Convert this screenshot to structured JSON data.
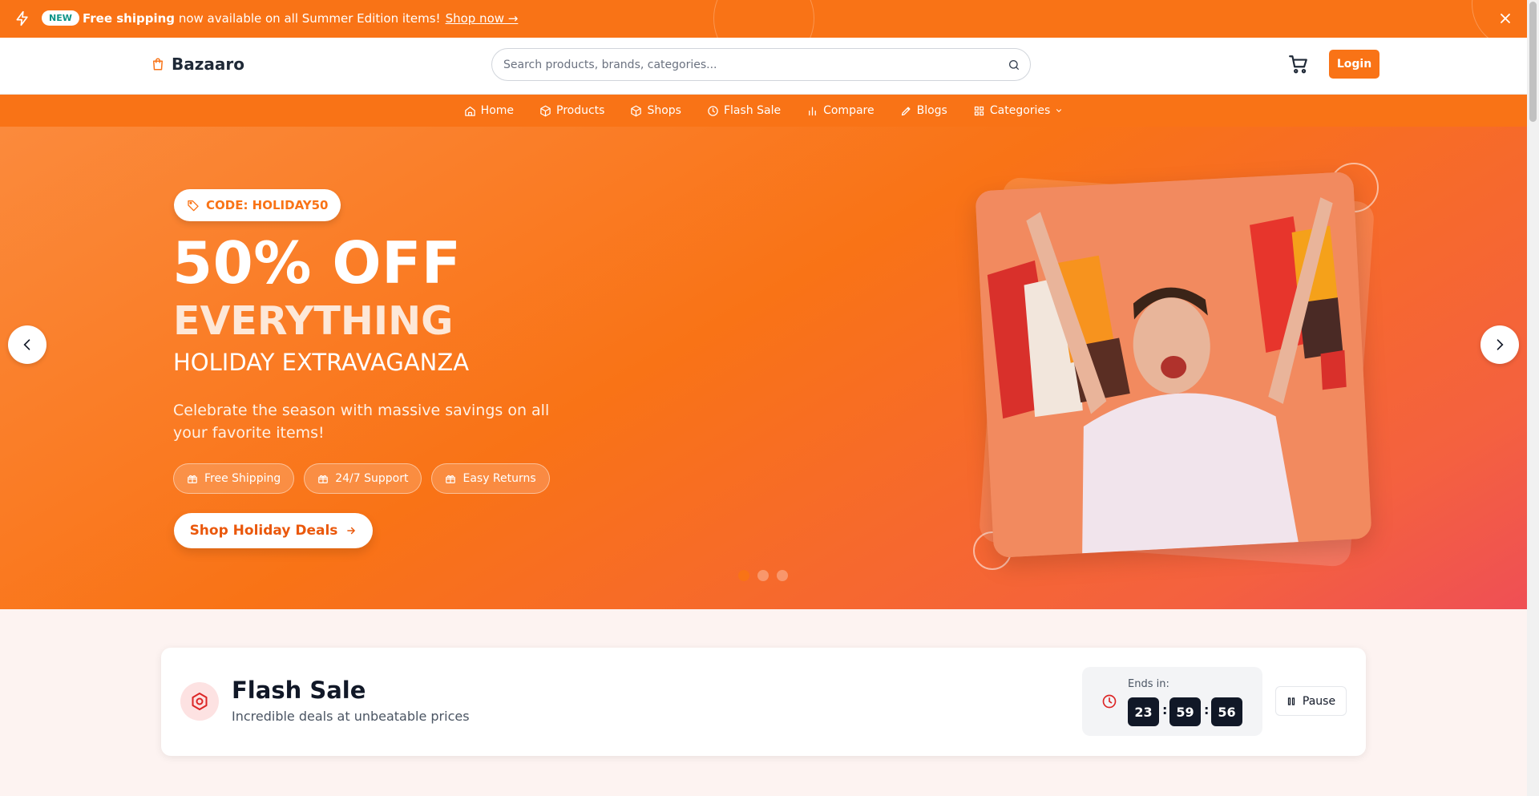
{
  "announcement": {
    "badge": "NEW",
    "bold_text": "Free shipping",
    "text": " now available on all Summer Edition items!",
    "link": "Shop now →"
  },
  "header": {
    "brand": "Bazaaro",
    "search_placeholder": "Search products, brands, categories...",
    "login_label": "Login"
  },
  "nav": {
    "items": [
      {
        "label": "Home",
        "icon": "home-icon"
      },
      {
        "label": "Products",
        "icon": "box-icon"
      },
      {
        "label": "Shops",
        "icon": "cube-icon"
      },
      {
        "label": "Flash Sale",
        "icon": "clock-icon"
      },
      {
        "label": "Compare",
        "icon": "bar-chart-icon"
      },
      {
        "label": "Blogs",
        "icon": "pen-icon"
      },
      {
        "label": "Categories",
        "icon": "grid-icon"
      }
    ]
  },
  "hero": {
    "code": "CODE: HOLIDAY50",
    "headline": "50% OFF",
    "subheadline": "EVERYTHING",
    "tagline": "HOLIDAY EXTRAVAGANZA",
    "description": "Celebrate the season with massive savings on all your favorite items!",
    "features": [
      "Free Shipping",
      "24/7 Support",
      "Easy Returns"
    ],
    "cta_label": "Shop Holiday Deals",
    "slide_count": 3,
    "active_slide": 1
  },
  "flash_sale": {
    "title": "Flash Sale",
    "subtitle": "Incredible deals at unbeatable prices",
    "ends_label": "Ends in:",
    "hours": "23",
    "minutes": "59",
    "seconds": "56",
    "pause_label": "Pause"
  },
  "colors": {
    "accent": "#f97316",
    "hero_end": "#ef4f55",
    "dark": "#111827"
  }
}
